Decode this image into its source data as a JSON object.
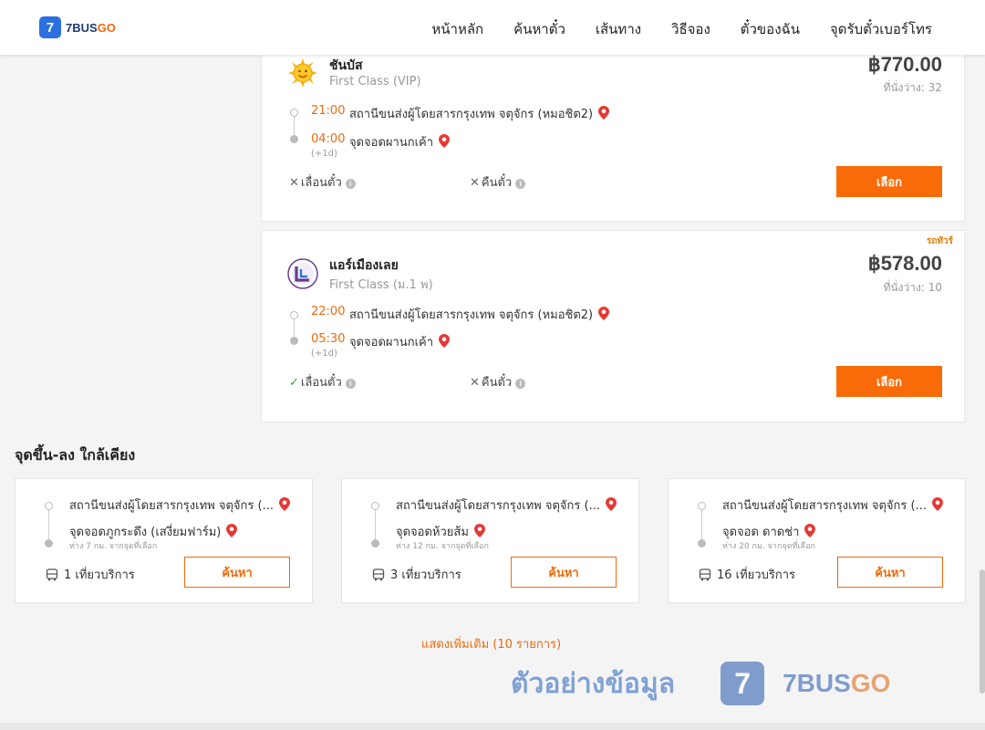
{
  "header": {
    "logo_mark": "7",
    "logo_text_main": "7BUS",
    "logo_text_accent": "GO",
    "nav": [
      "หน้าหลัก",
      "ค้นหาตั๋ว",
      "เส้นทาง",
      "วิธีจอง",
      "ตั๋วของฉัน",
      "จุดรับตั๋วเบอร์โทร"
    ]
  },
  "trips": [
    {
      "operator": "ชันบัส",
      "class": "First Class (VIP)",
      "price": "฿770.00",
      "seats": "ที่นั่งว่าง: 32",
      "promo": "",
      "depart_time": "21:00",
      "depart_stop": "สถานีขนส่งผู้โดยสารกรุงเทพ จตุจักร (หมอชิต2)",
      "arrive_time": "04:00",
      "arrive_stop": "จุดจอดผานกเค้า",
      "next_day": "(+1d)",
      "reschedule": "เลื่อนตั๋ว",
      "reschedule_allowed": false,
      "refund": "คืนตั๋ว",
      "refund_allowed": false,
      "select_label": "เลือก"
    },
    {
      "operator": "แอร์เมืองเลย",
      "class": "First Class (ม.1 พ)",
      "price": "฿578.00",
      "seats": "ที่นั่งว่าง: 10",
      "promo": "รถทัวร์",
      "depart_time": "22:00",
      "depart_stop": "สถานีขนส่งผู้โดยสารกรุงเทพ จตุจักร (หมอชิต2)",
      "arrive_time": "05:30",
      "arrive_stop": "จุดจอดผานกเค้า",
      "next_day": "(+1d)",
      "reschedule": "เลื่อนตั๋ว",
      "reschedule_allowed": true,
      "refund": "คืนตั๋ว",
      "refund_allowed": false,
      "select_label": "เลือก"
    }
  ],
  "nearby": {
    "title": "จุดขึ้น-ลง ใกล้เคียง",
    "items": [
      {
        "from": "สถานีขนส่งผู้โดยสารกรุงเทพ จตุจักร (...",
        "to": "จุดจอดภูกระดึง (เสงี่ยมฟาร์ม)",
        "distance": "ห่าง 7 กม. จากจุดที่เลือก",
        "trips": "1 เที่ยวบริการ",
        "search_label": "ค้นหา"
      },
      {
        "from": "สถานีขนส่งผู้โดยสารกรุงเทพ จตุจักร (...",
        "to": "จุดจอดห้วยส้ม",
        "distance": "ห่าง 12 กม. จากจุดที่เลือก",
        "trips": "3 เที่ยวบริการ",
        "search_label": "ค้นหา"
      },
      {
        "from": "สถานีขนส่งผู้โดยสารกรุงเทพ จตุจักร (...",
        "to": "จุดจอด ดาดช่า",
        "distance": "ห่าง 20 กม. จากจุดที่เลือก",
        "trips": "16 เที่ยวบริการ",
        "search_label": "ค้นหา"
      }
    ],
    "show_more": "แสดงเพิ่มเติม (10 รายการ)"
  },
  "watermark": {
    "text": "ตัวอย่างข้อมูล",
    "logo_mark": "7",
    "brand_main": "7BUS",
    "brand_accent": "GO"
  },
  "colors": {
    "accent": "#f96b08",
    "brand_blue": "#2b6fe0",
    "ok_green": "#2eaa3a"
  }
}
